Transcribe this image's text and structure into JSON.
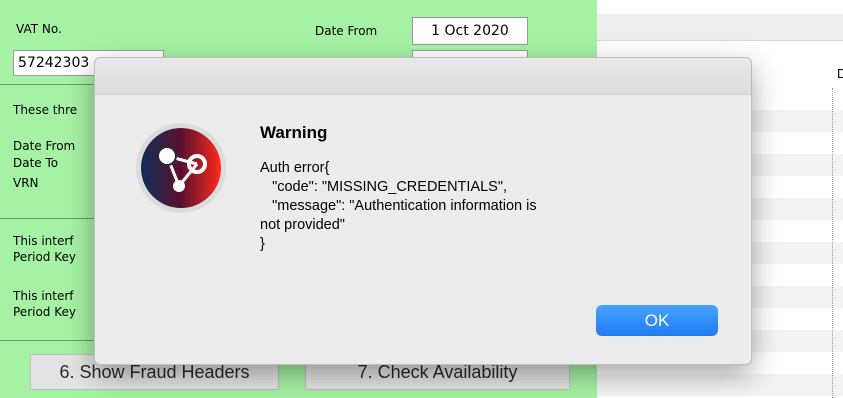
{
  "form": {
    "vat_label": "VAT No.",
    "vat_value": "57242303",
    "date_from_label": "Date From",
    "date_from_value": "1 Oct 2020",
    "info_text_1": "These thre",
    "info_date_from": "Date From",
    "info_date_to": "Date To",
    "info_vrn": "VRN",
    "info_text_2a": "This interf",
    "info_text_2b": "Period Key",
    "info_text_3a": "This interf",
    "info_text_3b": "Period Key",
    "btn_fraud": "6. Show Fraud Headers",
    "btn_check": "7. Check Availability"
  },
  "right_panel": {
    "column_header": "D"
  },
  "dialog": {
    "title": "Warning",
    "message": "Auth error{\n   \"code\": \"MISSING_CREDENTIALS\",\n   \"message\": \"Authentication information is\nnot provided\"\n}",
    "ok_label": "OK",
    "icon": "app-network-icon"
  },
  "colors": {
    "panel_green": "#a6f2a4",
    "ok_blue": "#1d7cf2"
  }
}
